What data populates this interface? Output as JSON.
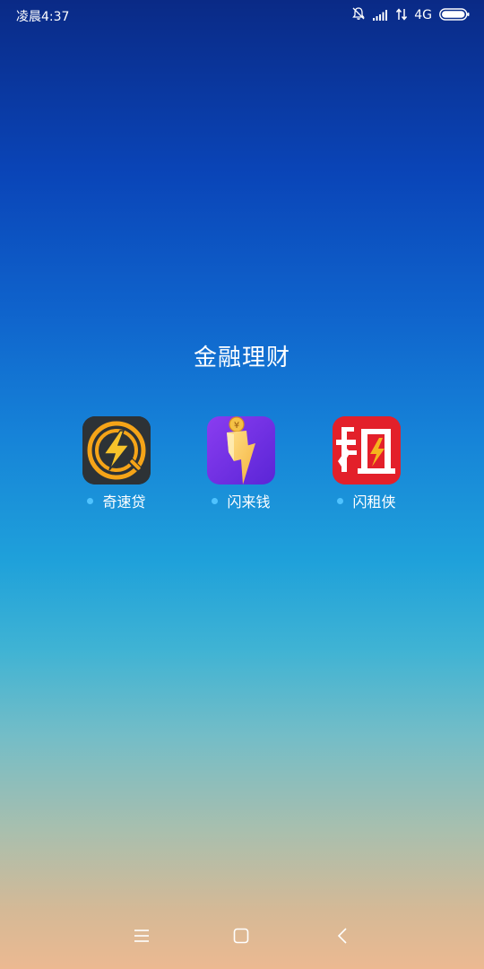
{
  "status_bar": {
    "time": "凌晨4:37",
    "network": "4G",
    "icons": [
      "bell-muted-icon",
      "signal-icon",
      "data-arrows-icon",
      "battery-icon"
    ]
  },
  "folder": {
    "title": "金融理财"
  },
  "apps": [
    {
      "name": "奇速贷",
      "icon": "qisudai-app-icon",
      "new_dot": true
    },
    {
      "name": "闪来钱",
      "icon": "shanlaiqian-app-icon",
      "new_dot": true
    },
    {
      "name": "闪租侠",
      "icon": "shanzuxia-app-icon",
      "new_dot": true
    }
  ],
  "nav_bar": {
    "icons": [
      "menu-icon",
      "home-icon",
      "back-icon"
    ]
  },
  "colors": {
    "background_top": "#0a2a86",
    "background_bottom": "#ecb991",
    "new_dot": "#4fc3ff"
  }
}
